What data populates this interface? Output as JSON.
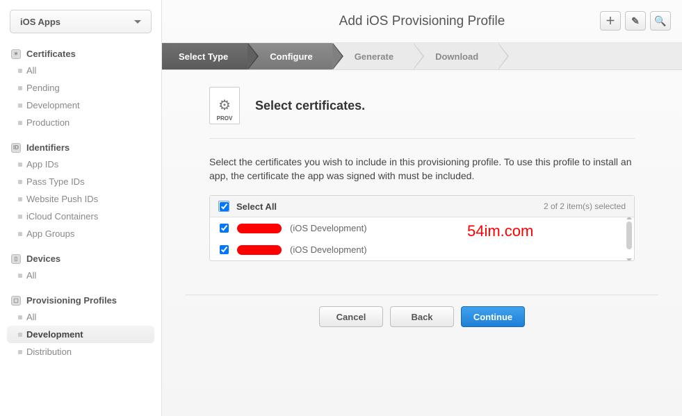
{
  "sidebar": {
    "selector_label": "iOS Apps",
    "sections": [
      {
        "title": "Certificates",
        "icon": "cert-icon",
        "items": [
          {
            "label": "All"
          },
          {
            "label": "Pending"
          },
          {
            "label": "Development"
          },
          {
            "label": "Production"
          }
        ]
      },
      {
        "title": "Identifiers",
        "icon": "id-icon",
        "items": [
          {
            "label": "App IDs"
          },
          {
            "label": "Pass Type IDs"
          },
          {
            "label": "Website Push IDs"
          },
          {
            "label": "iCloud Containers"
          },
          {
            "label": "App Groups"
          }
        ]
      },
      {
        "title": "Devices",
        "icon": "device-icon",
        "items": [
          {
            "label": "All"
          }
        ]
      },
      {
        "title": "Provisioning Profiles",
        "icon": "prov-icon",
        "items": [
          {
            "label": "All"
          },
          {
            "label": "Development",
            "active": true
          },
          {
            "label": "Distribution"
          }
        ]
      }
    ]
  },
  "header": {
    "title": "Add iOS Provisioning Profile"
  },
  "steps": [
    {
      "label": "Select Type",
      "state": "done"
    },
    {
      "label": "Configure",
      "state": "active"
    },
    {
      "label": "Generate",
      "state": ""
    },
    {
      "label": "Download",
      "state": ""
    }
  ],
  "section": {
    "icon_label": "PROV",
    "heading": "Select certificates.",
    "description": "Select the certificates you wish to include in this provisioning profile. To use this profile to install an app, the certificate the app was signed with must be included."
  },
  "certlist": {
    "select_all_label": "Select All",
    "count_text": "2 of 2 item(s) selected",
    "rows": [
      {
        "redacted": true,
        "suffix": "(iOS Development)",
        "checked": true
      },
      {
        "redacted": true,
        "suffix": "(iOS Development)",
        "checked": true
      }
    ]
  },
  "watermark": "54im.com",
  "buttons": {
    "cancel": "Cancel",
    "back": "Back",
    "continue": "Continue"
  }
}
